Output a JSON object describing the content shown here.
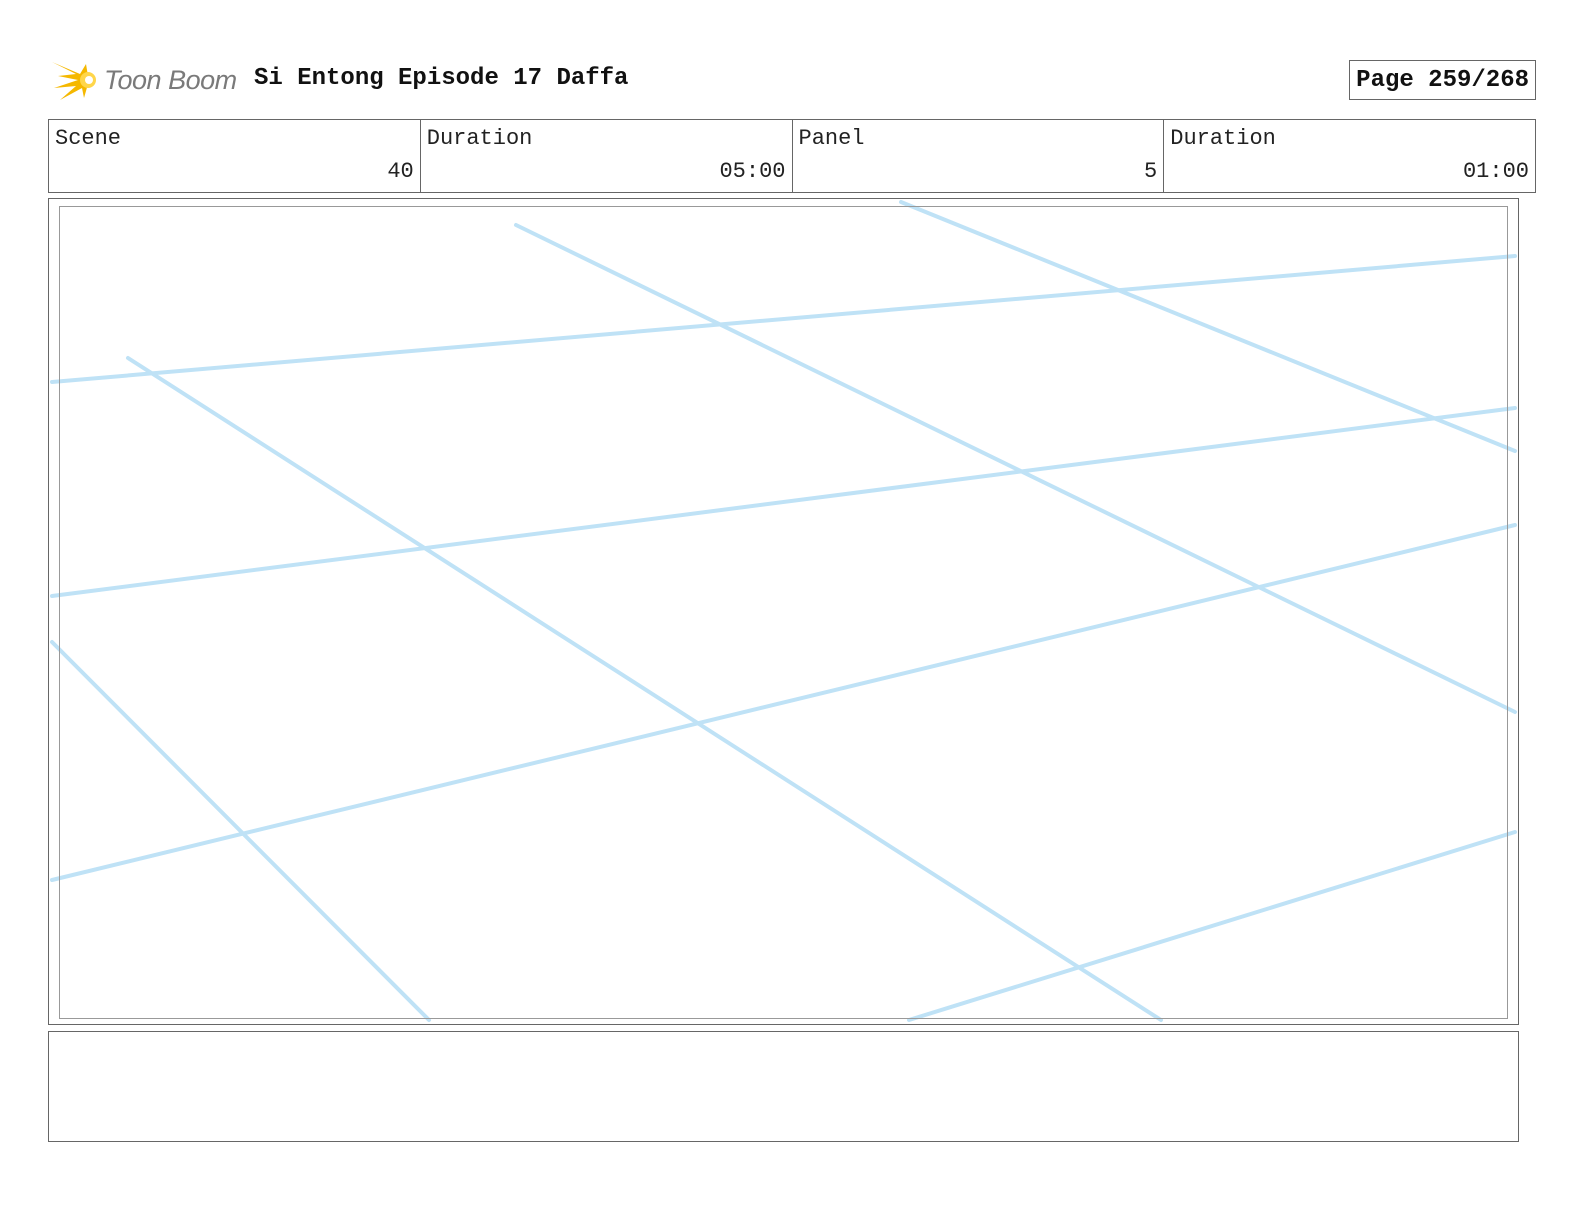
{
  "header": {
    "logo_text": "Toon Boom",
    "title": "Si Entong Episode 17 Daffa",
    "page": "Page 259/268"
  },
  "info": {
    "scene_label": "Scene",
    "scene_value": "40",
    "scene_duration_label": "Duration",
    "scene_duration_value": "05:00",
    "panel_label": "Panel",
    "panel_value": "5",
    "panel_duration_label": "Duration",
    "panel_duration_value": "01:00"
  },
  "colors": {
    "sketch_line": "#bfe2f6",
    "border": "#666666",
    "logo_flame": "#f5b800"
  },
  "notes": {
    "text": ""
  }
}
